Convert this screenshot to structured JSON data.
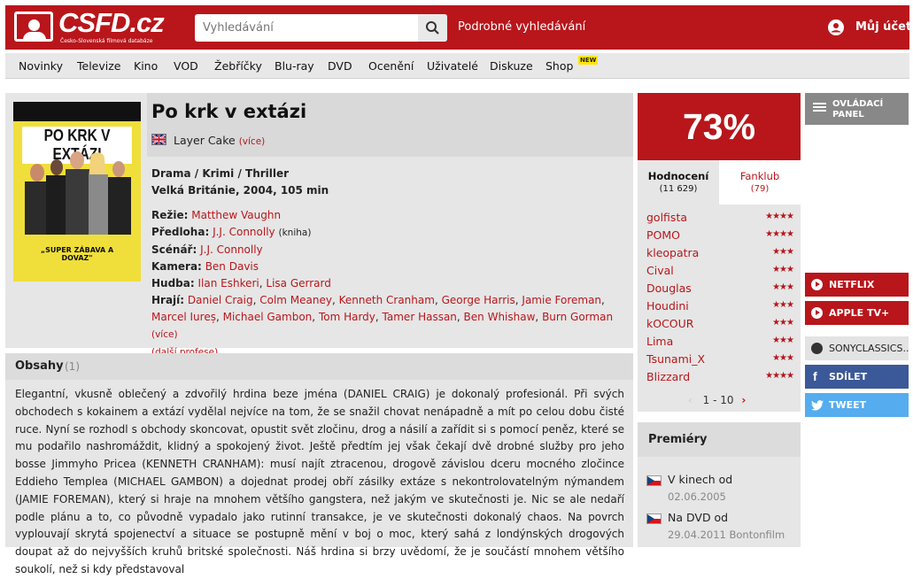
{
  "header": {
    "logo_text": "CSFD.cz",
    "logo_subtitle": "Česko-Slovenská filmová databáze",
    "search_placeholder": "Vyhledávání",
    "advanced_search": "Podrobné vyhledávání",
    "account": "Můj účet"
  },
  "nav": {
    "items": [
      "Novinky",
      "Televize",
      "Kino",
      "VOD",
      "Žebříčky",
      "Blu-ray",
      "DVD",
      "Ocenění",
      "Uživatelé",
      "Diskuze",
      "Shop"
    ],
    "new_badge": "NEW"
  },
  "film": {
    "title": "Po krk v extázi",
    "original_name": "Layer Cake",
    "original_more": "(více)",
    "genres": "Drama / Krimi / Thriller",
    "origin": "Velká Británie, 2004, 105 min",
    "directing_label": "Režie:",
    "director": "Matthew Vaughn",
    "source_label": "Předloha:",
    "source": "J.J. Connolly",
    "source_note": "(kniha)",
    "screenplay_label": "Scénář:",
    "screenplay": "J.J. Connolly",
    "camera_label": "Kamera:",
    "camera": "Ben Davis",
    "music_label": "Hudba:",
    "music": [
      "Ilan Eshkeri",
      "Lisa Gerrard"
    ],
    "cast_label": "Hrají:",
    "cast": [
      "Daniel Craig",
      "Colm Meaney",
      "Kenneth Cranham",
      "George Harris",
      "Jamie Foreman",
      "Marcel Iureș",
      "Michael Gambon",
      "Tom Hardy",
      "Tamer Hassan",
      "Ben Whishaw",
      "Burn Gorman"
    ],
    "cast_more": "(více)",
    "more_professions": "(další profese)",
    "poster": {
      "title": "PO KRK V EXTÁZI",
      "slogan": "„SUPER ZÁBAVA A DOVAZ\""
    }
  },
  "plot": {
    "title": "Obsahy",
    "count": "(1)",
    "text": "Elegantní, vkusně oblečený a zdvořilý hrdina beze jména (DANIEL CRAIG) je dokonalý profesionál. Při svých obchodech s kokainem a extází vydělal nejvíce na tom, že se snažil chovat nenápadně a mít po celou dobu čisté ruce. Nyní se rozhodl s obchody skoncovat, opustit svět zločinu, drog a násilí a zařídit si s pomocí peněz, které se mu podařilo nashromáždit, klidný a spokojený život. Ještě předtím jej však čekají dvě drobné služby pro jeho bosse Jimmyho Pricea (KENNETH CRANHAM): musí najít ztracenou, drogově závislou dceru mocného zločince Eddieho Templea (MICHAEL GAMBON) a dojednat prodej obří zásilky extáze s nekontrolovatelným nýmandem (JAMIE FOREMAN), který si hraje na mnohem většího gangstera, než jakým ve skutečnosti je. Nic se ale nedaří podle plánu a to, co původně vypadalo jako rutinní transakce, je ve skutečnosti dokonalý chaos. Na povrch vyplouvají skrytá spojenectví a situace se postupně mění v boj o moc, který sahá z londýnských drogových doupat až do nejvyšších kruhů britské společnosti. Náš hrdina si brzy uvědomí, že je součástí mnohem většího soukolí, než si kdy představoval"
  },
  "rating": {
    "score": "73%",
    "tab_ratings": "Hodnocení",
    "tab_ratings_count": "(11 629)",
    "tab_fanclub": "Fanklub",
    "tab_fanclub_count": "(79)",
    "users": [
      {
        "name": "golfista",
        "stars": 4
      },
      {
        "name": "POMO",
        "stars": 4
      },
      {
        "name": "kleopatra",
        "stars": 3
      },
      {
        "name": "Cival",
        "stars": 3
      },
      {
        "name": "Douglas",
        "stars": 3
      },
      {
        "name": "Houdini",
        "stars": 3
      },
      {
        "name": "kOCOUR",
        "stars": 3
      },
      {
        "name": "Lima",
        "stars": 3
      },
      {
        "name": "Tsunami_X",
        "stars": 3
      },
      {
        "name": "Blizzard",
        "stars": 4
      }
    ],
    "pager": "1 - 10"
  },
  "premieres": {
    "title": "Premiéry",
    "items": [
      {
        "label": "V kinech od",
        "date": "02.06.2005"
      },
      {
        "label": "Na DVD od",
        "date": "29.04.2011 Bontonfilm"
      }
    ]
  },
  "sidebar": {
    "panel_label": "OVLÁDACÍ PANEL",
    "netflix": "NETFLIX",
    "appletv": "APPLE TV+",
    "sony": "SONYCLASSICS...",
    "share": "SDÍLET",
    "tweet": "TWEET"
  },
  "colors": {
    "brand_red": "#b8161b",
    "facebook": "#3b5998",
    "twitter": "#55acee"
  }
}
